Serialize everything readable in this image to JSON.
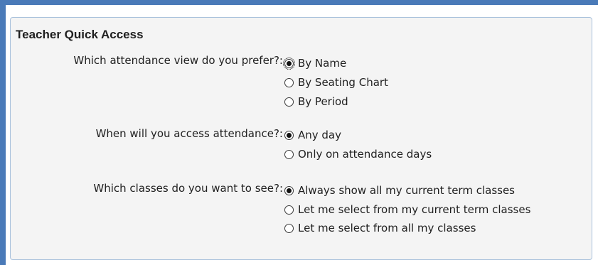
{
  "panel": {
    "title": "Teacher Quick Access"
  },
  "questions": [
    {
      "label": "Which attendance view do you prefer?:",
      "options": [
        {
          "label": "By Name",
          "checked": true
        },
        {
          "label": "By Seating Chart",
          "checked": false
        },
        {
          "label": "By Period",
          "checked": false
        }
      ]
    },
    {
      "label": "When will you access attendance?:",
      "options": [
        {
          "label": "Any day",
          "checked": true
        },
        {
          "label": "Only on attendance days",
          "checked": false
        }
      ]
    },
    {
      "label": "Which classes do you want to see?:",
      "options": [
        {
          "label": "Always show all my current term classes",
          "checked": true
        },
        {
          "label": "Let me select from my current term classes",
          "checked": false
        },
        {
          "label": "Let me select from all my classes",
          "checked": false
        }
      ]
    }
  ],
  "colors": {
    "accent_border": "#4a7ab8",
    "panel_bg": "#f4f4f4",
    "panel_border": "#a9c1dc"
  }
}
